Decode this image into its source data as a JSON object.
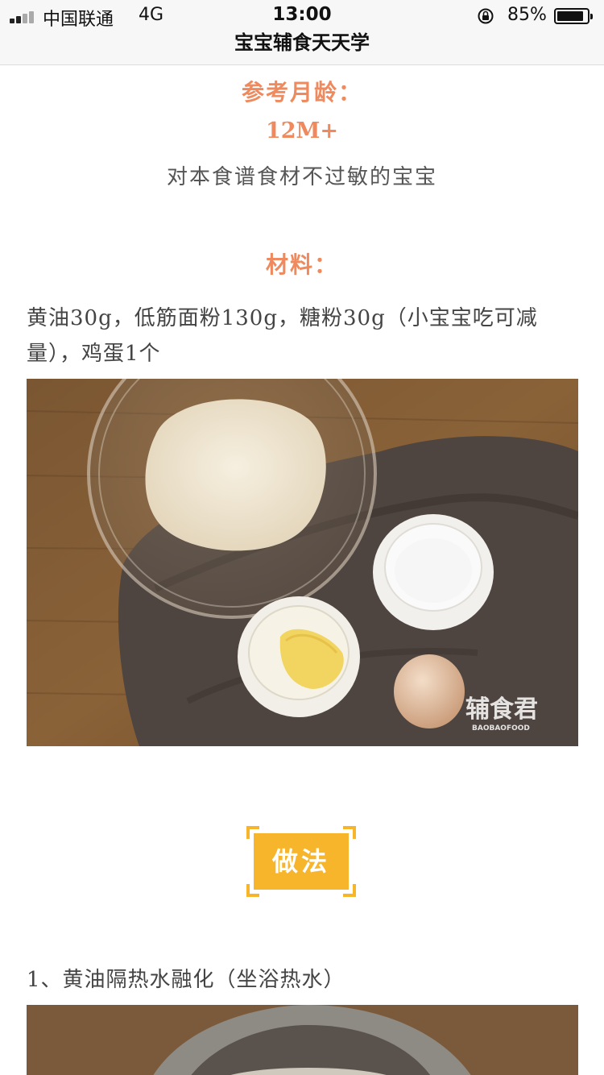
{
  "status_bar": {
    "carrier": "中国联通",
    "network": "4G",
    "time": "13:00",
    "battery_percent": "85%",
    "battery_level": 0.85
  },
  "nav": {
    "title": "宝宝辅食天天学"
  },
  "recipe": {
    "age_heading": "参考月龄：",
    "age_value": "12M+",
    "age_note": "对本食谱食材不过敏的宝宝",
    "materials_heading": "材料：",
    "materials_text": "黄油30g，低筋面粉130g，糖粉30g（小宝宝吃可减量），鸡蛋1个",
    "photo_watermark": "辅食君",
    "photo_watermark_sub": "BAOBAOFOOD",
    "method_label": "做法",
    "step1": "1、黄油隔热水融化（坐浴热水）"
  },
  "colors": {
    "accent_orange": "#ee8a5e",
    "badge_yellow": "#f7b52c",
    "bar_bg": "#f7f7f7"
  }
}
